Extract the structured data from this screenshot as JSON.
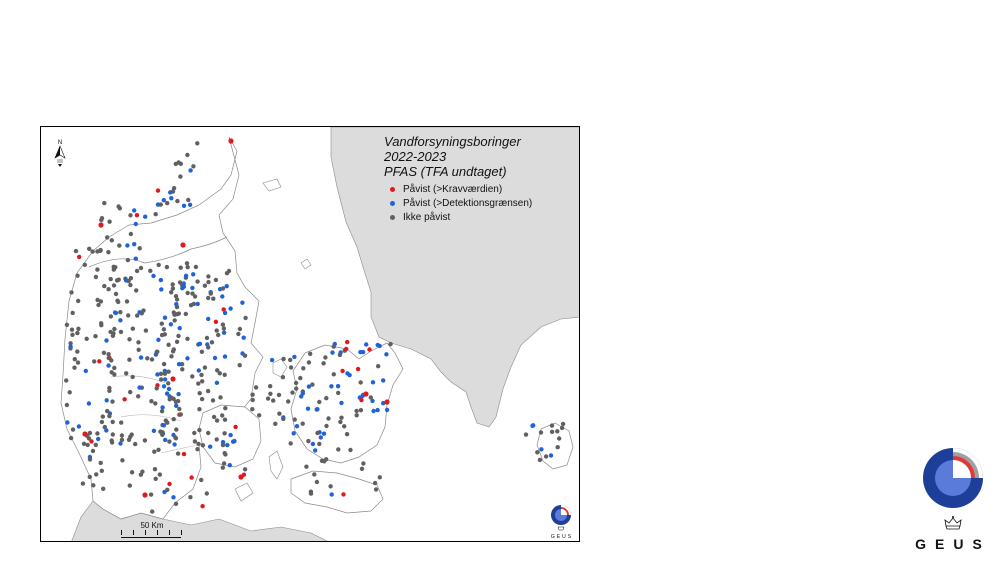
{
  "map": {
    "title_lines": [
      "Vandforsyningsboringer",
      "2022-2023",
      "PFAS (TFA undtaget)"
    ],
    "legend": [
      {
        "label": "Påvist (>Kravværdien)",
        "color": "#e1191d"
      },
      {
        "label": "Påvist (>Detektionsgrænsen)",
        "color": "#1f63d8"
      },
      {
        "label": "Ikke påvist",
        "color": "#606060"
      }
    ],
    "scale_label": "50 Km",
    "north_label": "N",
    "colors": {
      "sea": "#ffffff",
      "foreign_land": "#dcdcdc",
      "coast": "#8a8a8a"
    }
  },
  "logo": {
    "text": "GEUS",
    "mini_text": "GEUS",
    "colors": {
      "outer": "#1e3f99",
      "inner": "#5a7bd9",
      "accent": "#e03a33",
      "grey": "#a0a0a0"
    }
  }
}
